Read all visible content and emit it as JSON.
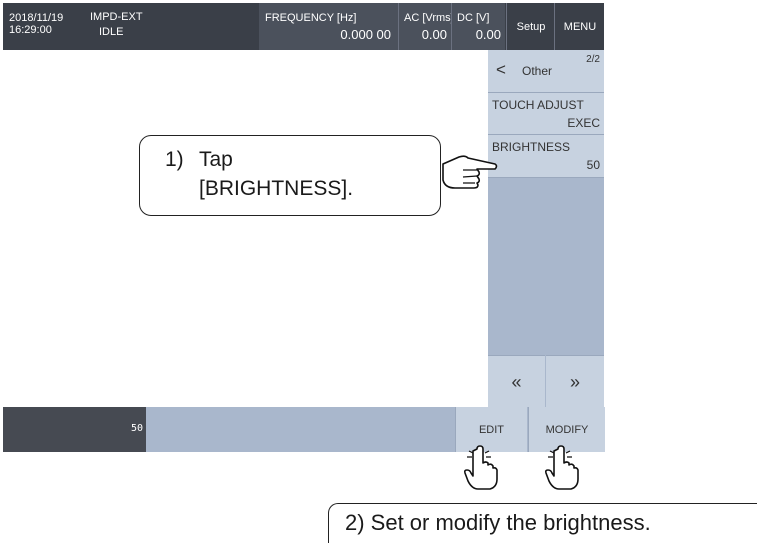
{
  "header": {
    "date": "2018/11/19",
    "time": "16:29:00",
    "mode": "IMPD-EXT",
    "state": "IDLE",
    "frequency_label": "FREQUENCY [Hz]",
    "frequency_value": "0.000 00",
    "ac_label": "AC [Vrms]",
    "ac_value": "0.00",
    "dc_label": "DC [V]",
    "dc_value": "0.00",
    "setup_label": "Setup",
    "menu_label": "MENU"
  },
  "panel": {
    "back_glyph": "<",
    "title": "Other",
    "page": "2/2",
    "items": [
      {
        "label": "TOUCH ADJUST",
        "value": "EXEC"
      },
      {
        "label": "BRIGHTNESS",
        "value": "50"
      }
    ],
    "prev_glyph": "«",
    "next_glyph": "»"
  },
  "bottom": {
    "value": "50",
    "edit_label": "EDIT",
    "modify_label": "MODIFY"
  },
  "callouts": {
    "step1_number": "1)",
    "step1_line1": "Tap",
    "step1_line2": "[BRIGHTNESS].",
    "step2_text": "2) Set or modify the brightness."
  }
}
